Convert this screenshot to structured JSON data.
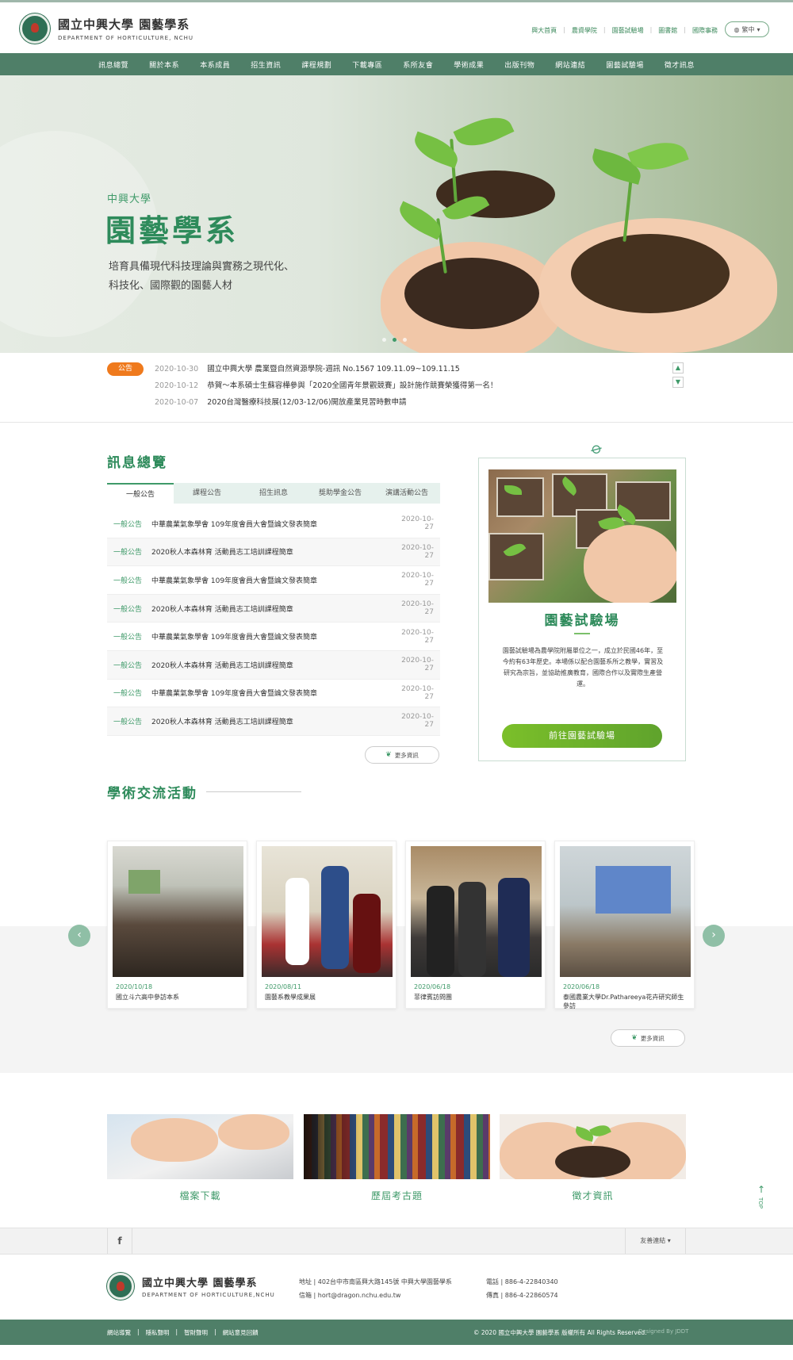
{
  "header": {
    "logo_cn": "國立中興大學 園藝學系",
    "logo_en": "DEPARTMENT OF HORTICULTURE, NCHU",
    "top_links": [
      "興大首頁",
      "農資學院",
      "園藝試驗場",
      "圖書館",
      "國際事務"
    ],
    "language": "繁中"
  },
  "nav": [
    "訊息總覽",
    "關於本系",
    "本系成員",
    "招生資訊",
    "課程規劃",
    "下載專區",
    "系所友會",
    "學術成果",
    "出版刊物",
    "網站連結",
    "園藝試驗場",
    "徵才訊息"
  ],
  "hero": {
    "subtitle": "中興大學",
    "title": "園藝學系",
    "desc_line1": "培育具備現代科技理論與實務之現代化、",
    "desc_line2": "科技化、國際觀的園藝人材"
  },
  "announcements": {
    "badge": "公告",
    "items": [
      {
        "date": "2020-10-30",
        "text": "國立中興大學 農業暨自然資源學院-週訊 No.1567 109.11.09~109.11.15"
      },
      {
        "date": "2020-10-12",
        "text": "恭賀～本系碩士生蘇容樺參與「2020全國青年景觀競賽」設計施作競賽榮獲得第一名！"
      },
      {
        "date": "2020-10-07",
        "text": "2020台灣醫療科技展(12/03-12/06)開放產業見習時數申請"
      }
    ]
  },
  "news": {
    "title": "訊息總覽",
    "tabs": [
      "一般公告",
      "課程公告",
      "招生訊息",
      "獎助學金公告",
      "演講活動公告"
    ],
    "rows": [
      {
        "cat": "一般公告",
        "text": "中華農業氣象學會 109年度會員大會暨論文發表簡章",
        "date": "2020-10-27"
      },
      {
        "cat": "一般公告",
        "text": "2020秋人本森林育 活動員志工培訓課程簡章",
        "date": "2020-10-27"
      },
      {
        "cat": "一般公告",
        "text": "中華農業氣象學會 109年度會員大會暨論文發表簡章",
        "date": "2020-10-27"
      },
      {
        "cat": "一般公告",
        "text": "2020秋人本森林育 活動員志工培訓課程簡章",
        "date": "2020-10-27"
      },
      {
        "cat": "一般公告",
        "text": "中華農業氣象學會 109年度會員大會暨論文發表簡章",
        "date": "2020-10-27"
      },
      {
        "cat": "一般公告",
        "text": "2020秋人本森林育 活動員志工培訓課程簡章",
        "date": "2020-10-27"
      },
      {
        "cat": "一般公告",
        "text": "中華農業氣象學會 109年度會員大會暨論文發表簡章",
        "date": "2020-10-27"
      },
      {
        "cat": "一般公告",
        "text": "2020秋人本森林育 活動員志工培訓課程簡章",
        "date": "2020-10-27"
      }
    ],
    "more": "更多資訊"
  },
  "farm": {
    "title": "園藝試驗場",
    "desc": "園藝試驗場為農學院附屬單位之一，成立於民國46年，至今約有63年歷史。本場係以配合園藝系所之教學，實習及研究為宗旨，並協助推廣教育，國際合作以及實際生產營運。",
    "button": "前往園藝試驗場"
  },
  "academic": {
    "title": "學術交流活動",
    "cards": [
      {
        "date": "2020/10/18",
        "text": "國立斗六高中參訪本系"
      },
      {
        "date": "2020/08/11",
        "text": "園藝系教學成果展"
      },
      {
        "date": "2020/06/18",
        "text": "菲律賓訪問團"
      },
      {
        "date": "2020/06/18",
        "text": "泰國農業大學Dr.Pathareeya花卉研究師生參訪"
      }
    ],
    "more": "更多資訊"
  },
  "quick": [
    {
      "label": "檔案下載"
    },
    {
      "label": "歷屆考古題"
    },
    {
      "label": "徵才資訊"
    }
  ],
  "top_label": "TOP",
  "social": {
    "fb": "f",
    "friend": "友善連結"
  },
  "footer": {
    "logo_cn": "國立中興大學 園藝學系",
    "logo_en": "DEPARTMENT OF HORTICULTURE,NCHU",
    "address": "地址 | 402台中市南區興大路145號 中興大學園藝學系",
    "email": "信箱 | hort@dragon.nchu.edu.tw",
    "phone": "電話 | 886-4-22840340",
    "fax": "傳真 | 886-4-22860574",
    "links": [
      "網站導覽",
      "隱私聲明",
      "智財聲明",
      "網站意見回饋"
    ],
    "copyright": "© 2020 國立中興大學 園藝學系 版權所有 All Rights Reserved.",
    "designed": "Designed By JDDT"
  },
  "colors": {
    "brand": "#4f7f68",
    "accent": "#3f9a69",
    "badge": "#ef7a1d",
    "button": "#6aaf2b"
  }
}
